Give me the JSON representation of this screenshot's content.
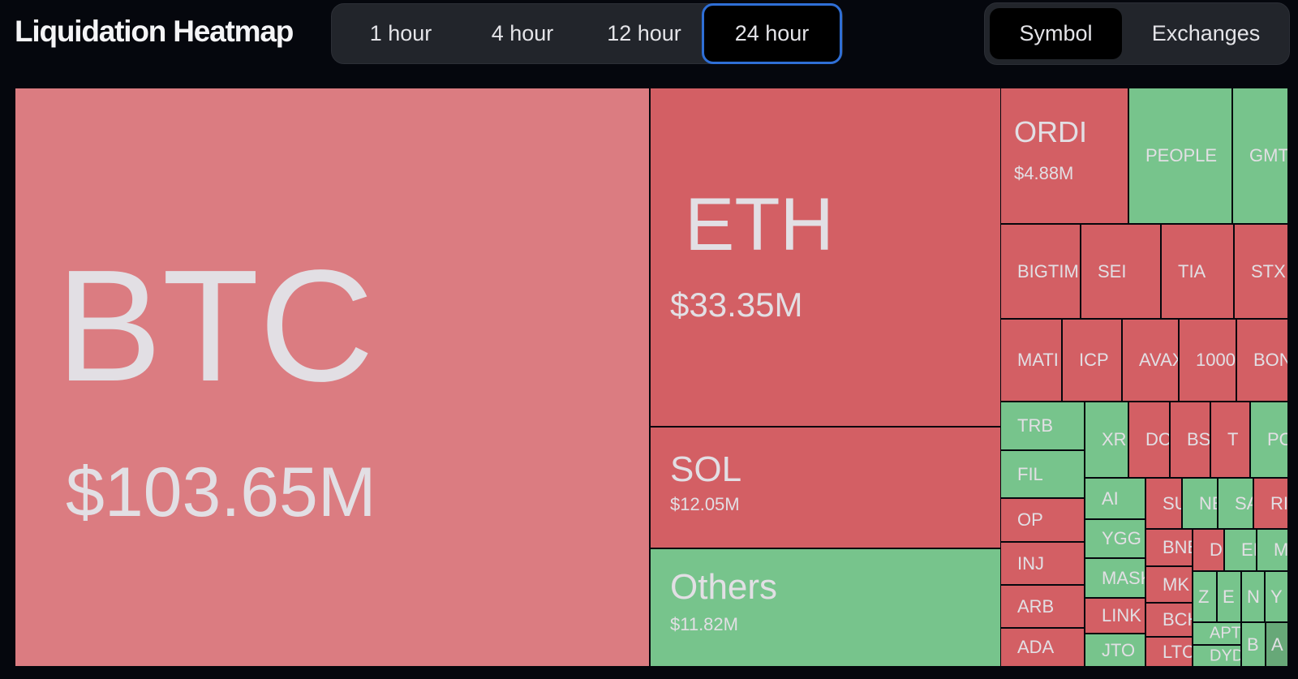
{
  "header": {
    "title": "Liquidation Heatmap"
  },
  "time_tabs": [
    {
      "label": "1 hour",
      "active": false
    },
    {
      "label": "4 hour",
      "active": false
    },
    {
      "label": "12 hour",
      "active": false
    },
    {
      "label": "24 hour",
      "active": true
    }
  ],
  "view_tabs": [
    {
      "label": "Symbol",
      "active": true
    },
    {
      "label": "Exchanges",
      "active": false
    }
  ],
  "colors": {
    "long_red": "#d35f64",
    "btc_red": "#db7c81",
    "short_green": "#77c48c",
    "dark_green": "#67a878",
    "accent_blue": "#2f6fd6",
    "background": "#05070d"
  },
  "cells": [
    {
      "symbol": "BTC",
      "value": "$103.65M",
      "color": "btc_red"
    },
    {
      "symbol": "ETH",
      "value": "$33.35M",
      "color": "long_red"
    },
    {
      "symbol": "SOL",
      "value": "$12.05M",
      "color": "long_red"
    },
    {
      "symbol": "Others",
      "value": "$11.82M",
      "color": "short_green"
    },
    {
      "symbol": "ORDI",
      "value": "$4.88M",
      "color": "long_red"
    },
    {
      "symbol": "PEOPLE",
      "color": "short_green"
    },
    {
      "symbol": "GMT",
      "color": "short_green"
    },
    {
      "symbol": "BIGTIM",
      "color": "long_red"
    },
    {
      "symbol": "SEI",
      "color": "long_red"
    },
    {
      "symbol": "TIA",
      "color": "long_red"
    },
    {
      "symbol": "STX",
      "color": "long_red"
    },
    {
      "symbol": "MATI",
      "color": "long_red"
    },
    {
      "symbol": "ICP",
      "color": "long_red"
    },
    {
      "symbol": "AVAX",
      "color": "long_red"
    },
    {
      "symbol": "1000",
      "color": "long_red"
    },
    {
      "symbol": "BON",
      "color": "long_red"
    },
    {
      "symbol": "TRB",
      "color": "short_green"
    },
    {
      "symbol": "FIL",
      "color": "short_green"
    },
    {
      "symbol": "OP",
      "color": "long_red"
    },
    {
      "symbol": "INJ",
      "color": "long_red"
    },
    {
      "symbol": "ARB",
      "color": "long_red"
    },
    {
      "symbol": "ADA",
      "color": "long_red"
    },
    {
      "symbol": "XR",
      "color": "short_green"
    },
    {
      "symbol": "DC",
      "color": "long_red"
    },
    {
      "symbol": "BS",
      "color": "long_red"
    },
    {
      "symbol": "T",
      "color": "long_red"
    },
    {
      "symbol": "PO",
      "color": "short_green"
    },
    {
      "symbol": "AI",
      "color": "short_green"
    },
    {
      "symbol": "YGG",
      "color": "short_green"
    },
    {
      "symbol": "MASK",
      "color": "short_green"
    },
    {
      "symbol": "LINK",
      "color": "long_red"
    },
    {
      "symbol": "JTO",
      "color": "short_green"
    },
    {
      "symbol": "SU",
      "color": "long_red"
    },
    {
      "symbol": "NE",
      "color": "short_green"
    },
    {
      "symbol": "SA",
      "color": "short_green"
    },
    {
      "symbol": "RI",
      "color": "long_red"
    },
    {
      "symbol": "BNB",
      "color": "long_red"
    },
    {
      "symbol": "MK",
      "color": "long_red"
    },
    {
      "symbol": "BCH",
      "color": "long_red"
    },
    {
      "symbol": "LTC",
      "color": "long_red"
    },
    {
      "symbol": "D",
      "color": "long_red"
    },
    {
      "symbol": "EI",
      "color": "short_green"
    },
    {
      "symbol": "M",
      "color": "short_green"
    },
    {
      "symbol": "Z",
      "color": "short_green"
    },
    {
      "symbol": "E",
      "color": "short_green"
    },
    {
      "symbol": "N",
      "color": "short_green"
    },
    {
      "symbol": "Y",
      "color": "short_green"
    },
    {
      "symbol": "APT",
      "color": "short_green"
    },
    {
      "symbol": "DYD",
      "color": "short_green"
    },
    {
      "symbol": "B",
      "color": "short_green"
    },
    {
      "symbol": "A",
      "color": "dark_green"
    }
  ]
}
